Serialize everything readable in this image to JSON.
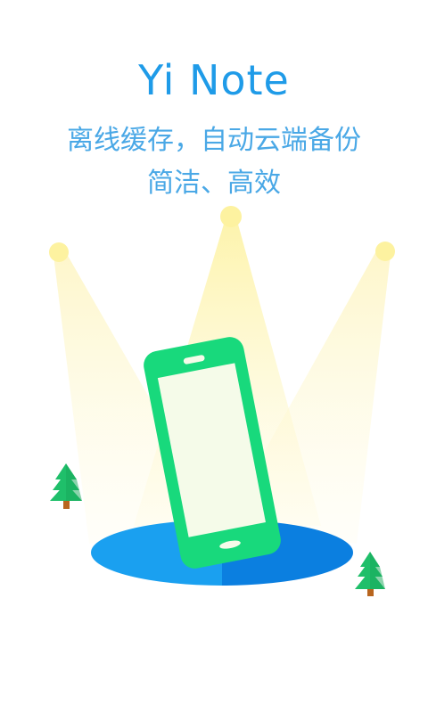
{
  "app": {
    "title": "Yi Note",
    "tagline_line1": "离线缓存，自动云端备份",
    "tagline_line2": "简洁、高效"
  },
  "illustration": {
    "subject": "phone-on-stage",
    "icons": [
      "spotlight-left",
      "spotlight-center",
      "spotlight-right",
      "phone",
      "stage",
      "tree-left",
      "tree-right"
    ]
  },
  "colors": {
    "title": "#1f9be8",
    "tagline": "#4aa8e6",
    "phone_body": "#18d97c",
    "phone_screen": "#f5fbe9",
    "stage_light": "#1aa0f0",
    "stage_dark": "#0b7fe0",
    "spotlight_bulb": "#fdf2a0",
    "tree_green": "#1fbf6a",
    "tree_trunk": "#b8651e"
  }
}
